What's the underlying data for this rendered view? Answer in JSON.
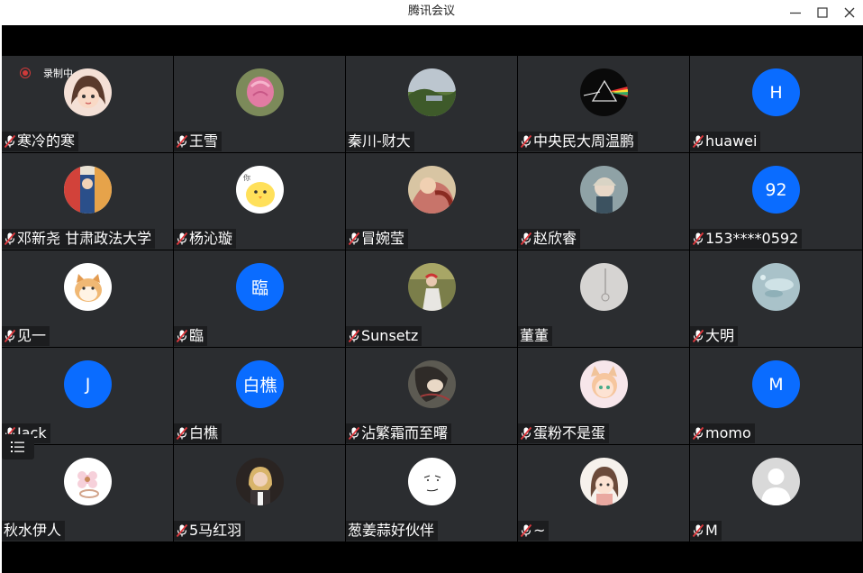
{
  "window": {
    "title": "腾讯会议",
    "controls": [
      "minimize",
      "maximize",
      "close"
    ]
  },
  "recording": {
    "label": "录制中"
  },
  "participants": [
    {
      "name": "寒冷的寒",
      "muted": true,
      "avatar": {
        "kind": "photo",
        "icon": "cartoon-girl-avatar"
      }
    },
    {
      "name": "王雪",
      "muted": true,
      "avatar": {
        "kind": "photo",
        "icon": "pink-flower-avatar"
      }
    },
    {
      "name": "秦川-财大",
      "muted": false,
      "avatar": {
        "kind": "photo",
        "icon": "landscape-avatar"
      }
    },
    {
      "name": "中央民大周温鹏",
      "muted": true,
      "avatar": {
        "kind": "photo",
        "icon": "prism-avatar"
      }
    },
    {
      "name": "huawei",
      "muted": true,
      "avatar": {
        "kind": "letter",
        "text": "H"
      }
    },
    {
      "name": "邓新尧 甘肃政法大学",
      "muted": true,
      "avatar": {
        "kind": "photo",
        "icon": "colorful-photo-avatar"
      }
    },
    {
      "name": "杨沁璇",
      "muted": true,
      "avatar": {
        "kind": "photo",
        "icon": "yellow-chick-avatar"
      }
    },
    {
      "name": "冒婉莹",
      "muted": true,
      "avatar": {
        "kind": "photo",
        "icon": "painting-avatar"
      }
    },
    {
      "name": "赵欣睿",
      "muted": true,
      "avatar": {
        "kind": "photo",
        "icon": "anime-boy-avatar"
      }
    },
    {
      "name": "153****0592",
      "muted": true,
      "avatar": {
        "kind": "letter",
        "text": "92"
      }
    },
    {
      "name": "见一",
      "muted": true,
      "avatar": {
        "kind": "photo",
        "icon": "shiba-dog-avatar"
      }
    },
    {
      "name": "臨",
      "muted": true,
      "avatar": {
        "kind": "letter",
        "text": "臨"
      }
    },
    {
      "name": "Sunsetz",
      "muted": true,
      "avatar": {
        "kind": "photo",
        "icon": "person-photo-avatar"
      }
    },
    {
      "name": "董董",
      "muted": false,
      "avatar": {
        "kind": "photo",
        "icon": "grey-wall-avatar"
      }
    },
    {
      "name": "大明",
      "muted": true,
      "avatar": {
        "kind": "photo",
        "icon": "water-drops-avatar"
      }
    },
    {
      "name": "Jack",
      "muted": true,
      "avatar": {
        "kind": "letter",
        "text": "J"
      }
    },
    {
      "name": "白樵",
      "muted": true,
      "avatar": {
        "kind": "letter",
        "text": "白樵"
      }
    },
    {
      "name": "沾繁霜而至曙",
      "muted": true,
      "avatar": {
        "kind": "photo",
        "icon": "anime-figure-avatar"
      }
    },
    {
      "name": "蛋粉不是蛋",
      "muted": true,
      "avatar": {
        "kind": "photo",
        "icon": "anime-catgirl-avatar"
      }
    },
    {
      "name": "momo",
      "muted": true,
      "avatar": {
        "kind": "letter",
        "text": "M"
      }
    },
    {
      "name": "秋水伊人",
      "muted": false,
      "avatar": {
        "kind": "photo",
        "icon": "flower-ring-avatar"
      }
    },
    {
      "name": "5马红羽",
      "muted": true,
      "avatar": {
        "kind": "photo",
        "icon": "blonde-woman-avatar"
      }
    },
    {
      "name": "葱姜蒜好伙伴",
      "muted": false,
      "avatar": {
        "kind": "photo",
        "icon": "sketch-face-avatar"
      }
    },
    {
      "name": "~",
      "muted": true,
      "avatar": {
        "kind": "photo",
        "icon": "illustrated-girl-avatar"
      }
    },
    {
      "name": "M",
      "muted": true,
      "avatar": {
        "kind": "photo",
        "icon": "default-user-avatar"
      }
    }
  ],
  "colors": {
    "tile_bg": "#2b2d30",
    "letter_avatar": "#0a6cff",
    "mute_red": "#e0393e",
    "record_red": "#d03a3a"
  }
}
